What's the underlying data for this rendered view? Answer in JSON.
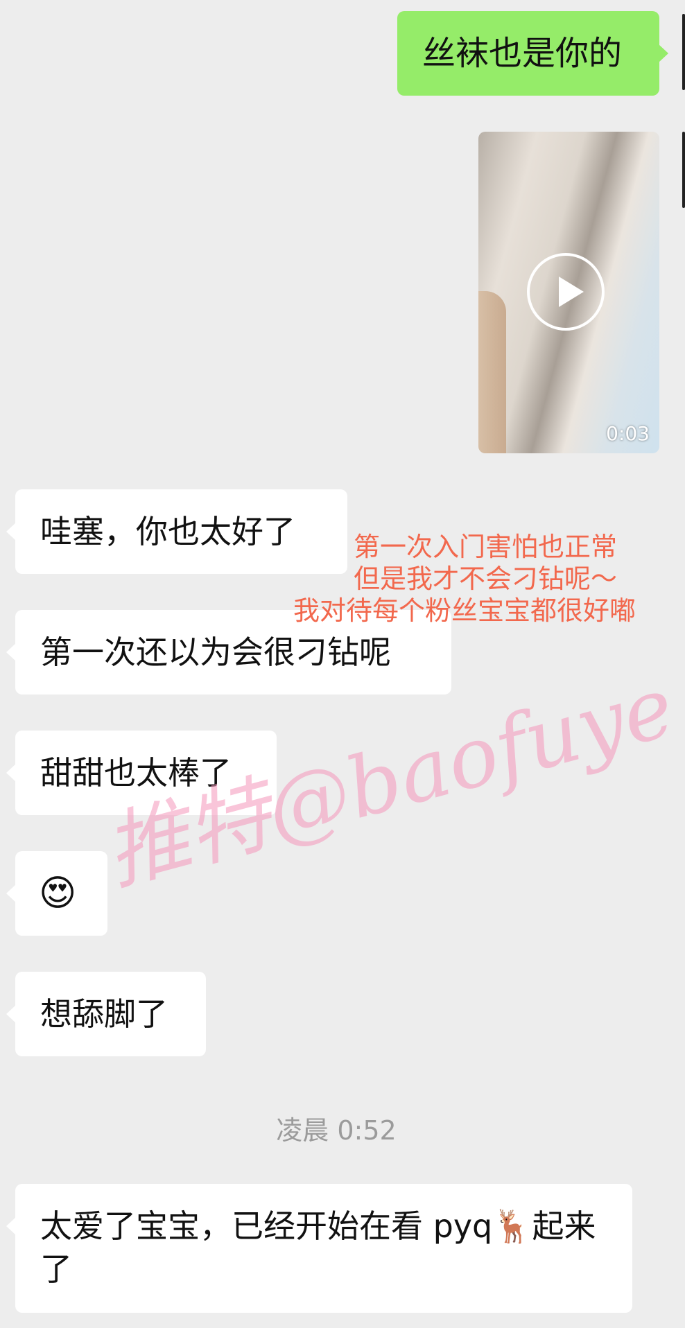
{
  "messages": [
    {
      "side": "right",
      "text": "丝袜也是你的"
    },
    {
      "side": "left",
      "text": "哇塞，你也太好了"
    },
    {
      "side": "left",
      "text": "第一次还以为会很刁钻呢"
    },
    {
      "side": "left",
      "text": "甜甜也太棒了"
    },
    {
      "side": "left",
      "text": "😍"
    },
    {
      "side": "left",
      "text": "想舔脚了"
    },
    {
      "side": "left",
      "text": "太爱了宝宝，已经开始在看 pyq🦌起来了"
    }
  ],
  "video": {
    "duration": "0:03",
    "icon": "play-icon"
  },
  "timestamp": "凌晨 0:52",
  "overlay_note": {
    "line1": "第一次入门害怕也正常",
    "line2": "但是我才不会刁钻呢～",
    "line3": "我对待每个粉丝宝宝都很好嘟",
    "color": "#f2684d"
  },
  "watermark": "推特@baofuye"
}
